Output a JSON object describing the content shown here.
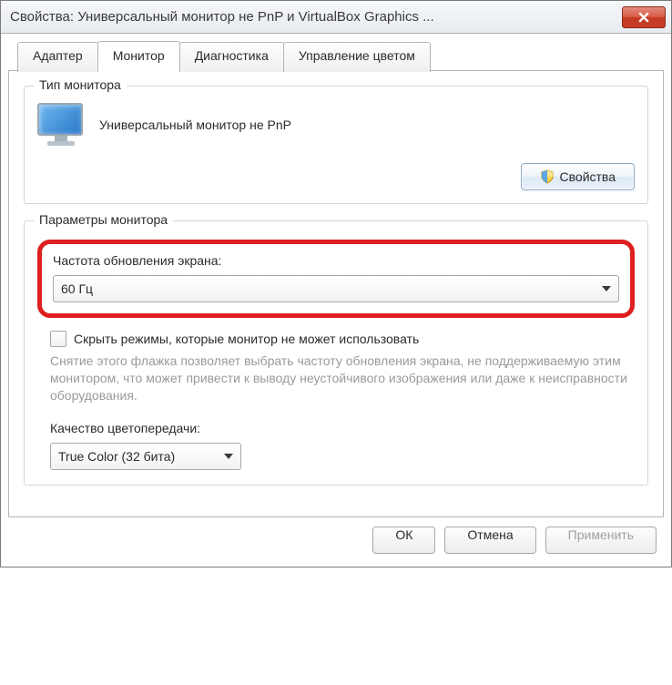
{
  "window": {
    "title": "Свойства: Универсальный монитор не PnP и VirtualBox Graphics ..."
  },
  "tabs": {
    "items": [
      {
        "label": "Адаптер"
      },
      {
        "label": "Монитор"
      },
      {
        "label": "Диагностика"
      },
      {
        "label": "Управление цветом"
      }
    ]
  },
  "monitor_type": {
    "group_title": "Тип монитора",
    "device_name": "Универсальный монитор не PnP",
    "properties_button": "Свойства"
  },
  "monitor_params": {
    "group_title": "Параметры монитора",
    "refresh_label": "Частота обновления экрана:",
    "refresh_value": "60 Гц",
    "hide_modes_label": "Скрыть режимы, которые монитор не может использовать",
    "hide_modes_hint": "Снятие этого флажка позволяет выбрать частоту обновления экрана, не поддерживаемую этим монитором, что может привести к выводу неустойчивого изображения или даже к неисправности оборудования.",
    "color_quality_label": "Качество цветопередачи:",
    "color_quality_value": "True Color (32 бита)"
  },
  "buttons": {
    "ok": "ОК",
    "cancel": "Отмена",
    "apply": "Применить"
  }
}
